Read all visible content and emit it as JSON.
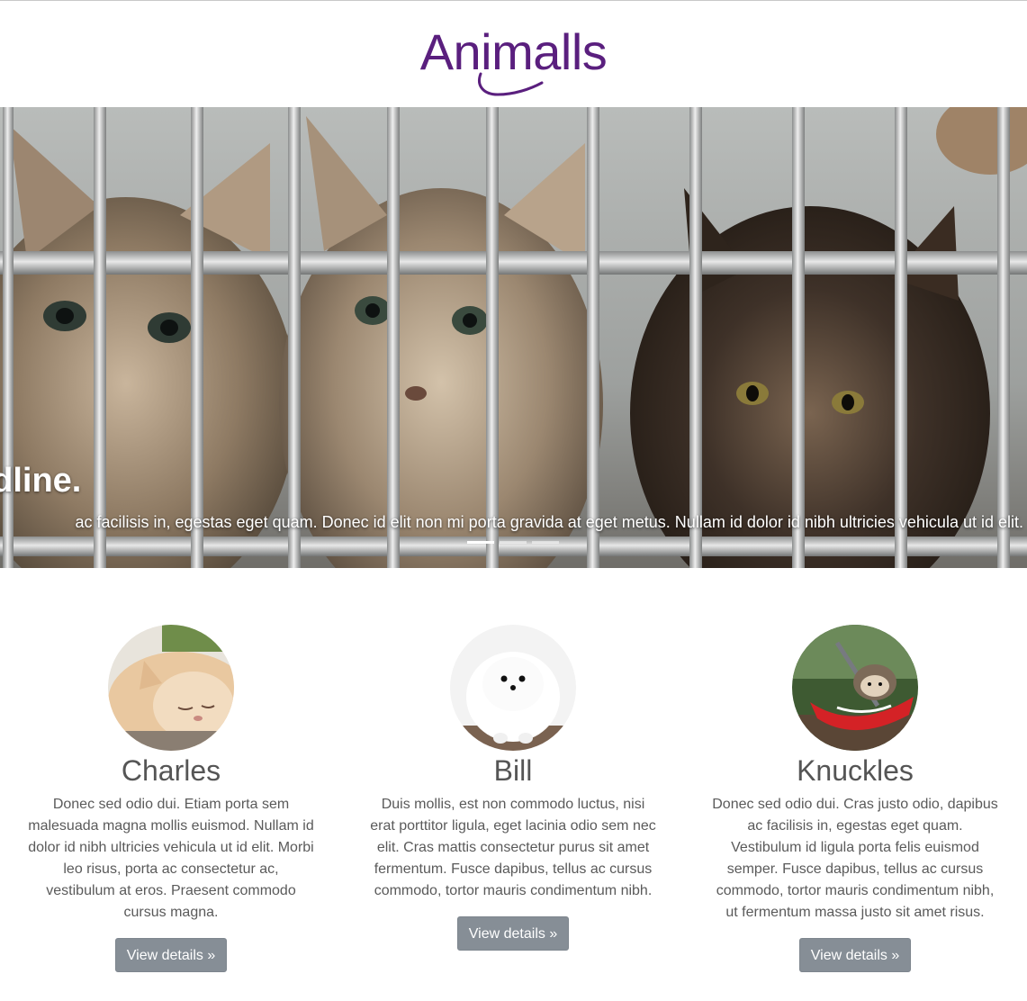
{
  "brand": {
    "name": "Animalls",
    "color": "#5a1f7e"
  },
  "carousel": {
    "headline": "adline.",
    "text": "ac facilisis in, egestas eget quam. Donec id elit non mi porta gravida at eget metus. Nullam id dolor id nibh ultricies vehicula ut id elit.",
    "active_slide": 1,
    "slide_count": 3
  },
  "features": [
    {
      "name": "Charles",
      "image": "persian-cat-photo",
      "description": "Donec sed odio dui. Etiam porta sem malesuada magna mollis euismod. Nullam id dolor id nibh ultricies vehicula ut id elit. Morbi leo risus, porta ac consectetur ac, vestibulum at eros. Praesent commodo cursus magna.",
      "button_label": "View details »"
    },
    {
      "name": "Bill",
      "image": "white-pomeranian-photo",
      "description": "Duis mollis, est non commodo luctus, nisi erat porttitor ligula, eget lacinia odio sem nec elit. Cras mattis consectetur purus sit amet fermentum. Fusce dapibus, tellus ac cursus commodo, tortor mauris condimentum nibh.",
      "button_label": "View details »"
    },
    {
      "name": "Knuckles",
      "image": "hedgehog-in-kayak-photo",
      "description": "Donec sed odio dui. Cras justo odio, dapibus ac facilisis in, egestas eget quam. Vestibulum id ligula porta felis euismod semper. Fusce dapibus, tellus ac cursus commodo, tortor mauris condimentum nibh, ut fermentum massa justo sit amet risus.",
      "button_label": "View details »"
    }
  ],
  "colors": {
    "button_bg": "#868e96",
    "text": "#555555"
  }
}
